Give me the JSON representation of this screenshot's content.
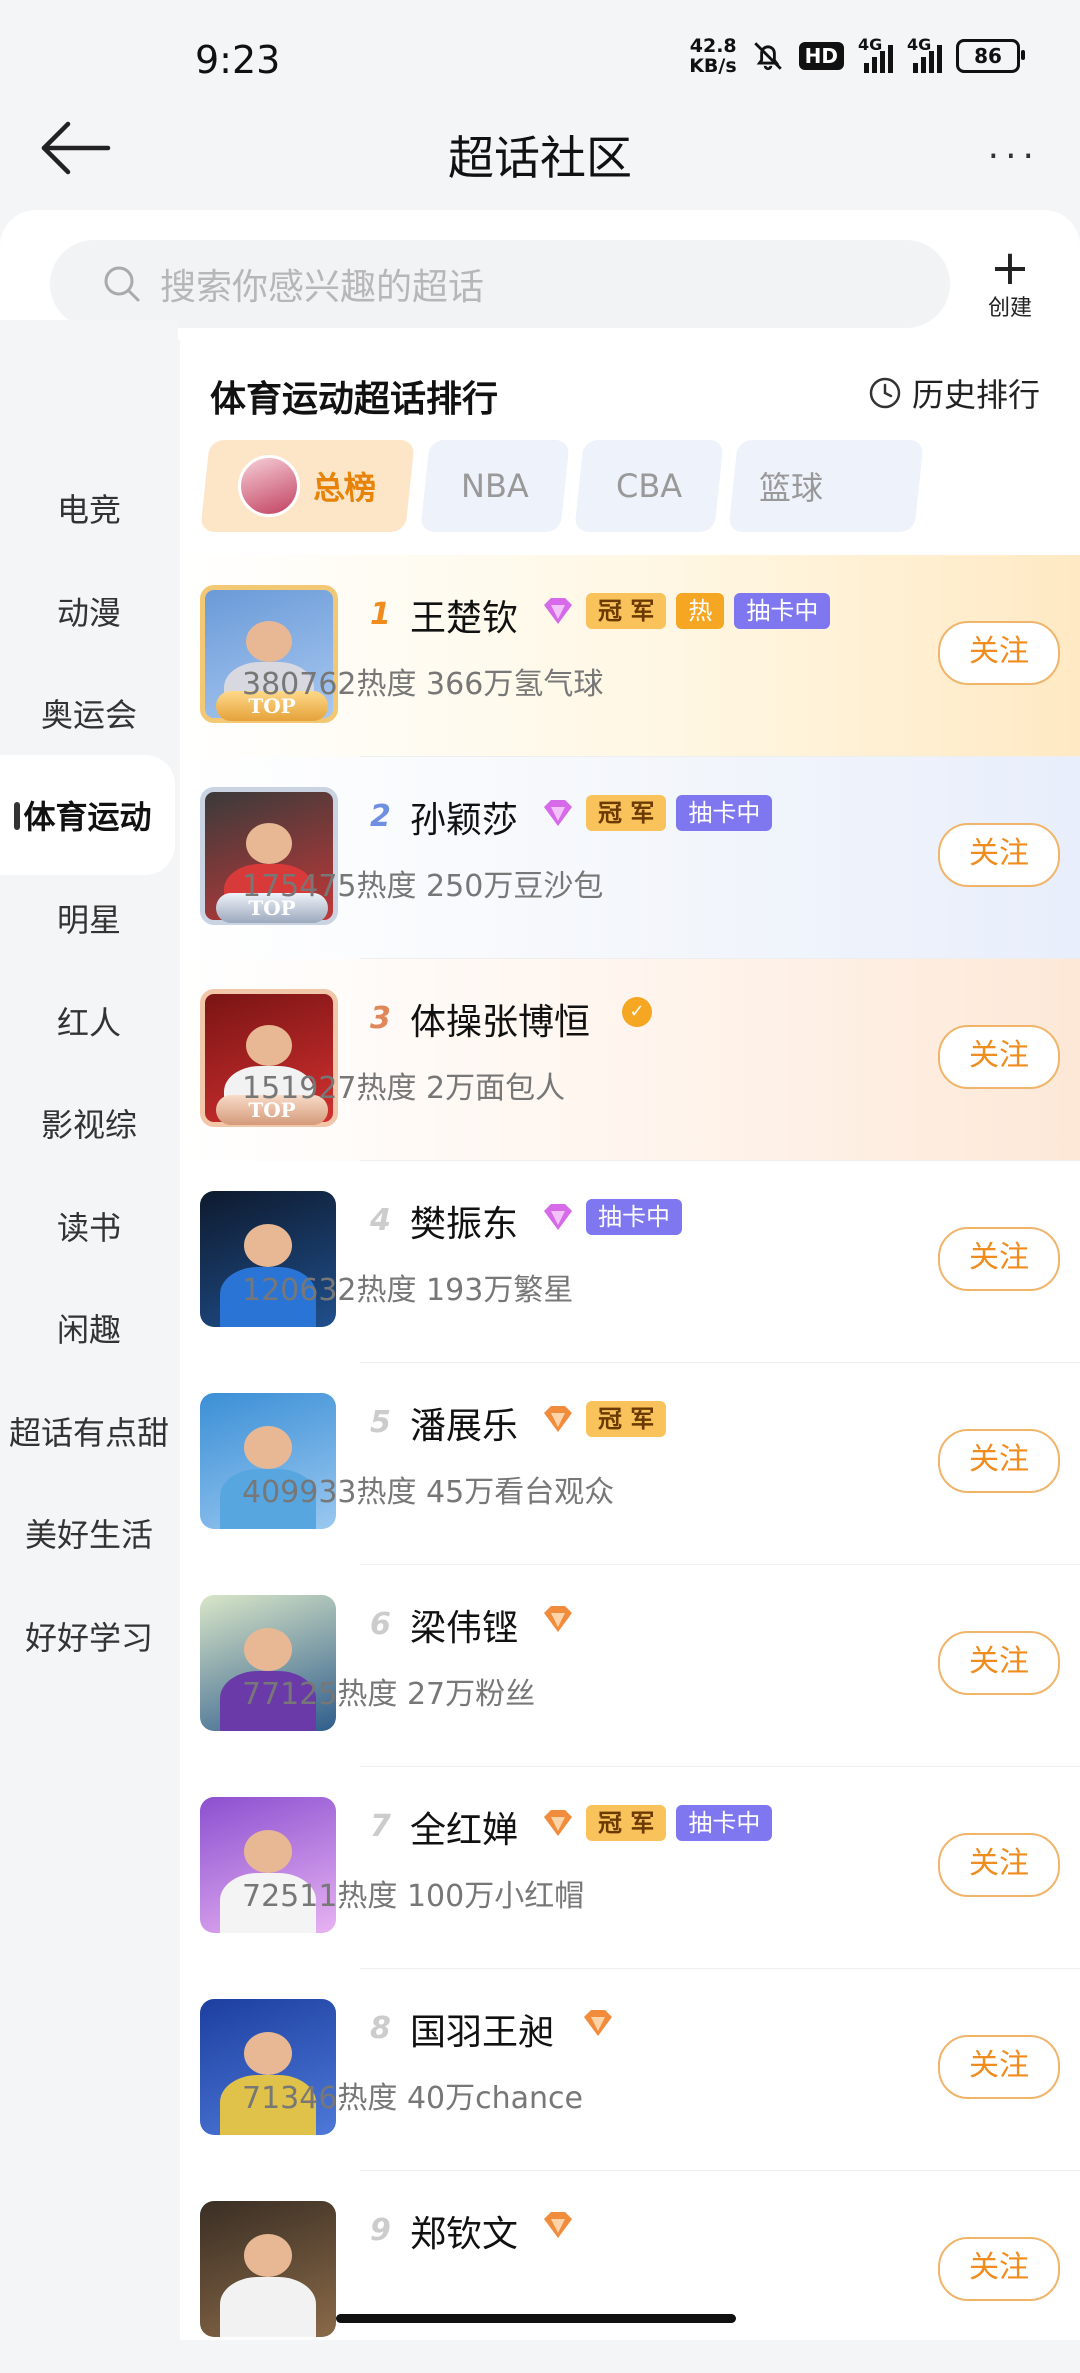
{
  "status_bar": {
    "time": "9:23",
    "net_speed_value": "42.8",
    "net_speed_unit": "KB/s",
    "hd_label": "HD",
    "signal1_label": "4G",
    "signal2_label": "4G",
    "battery": "86"
  },
  "header": {
    "title": "超话社区",
    "back_icon": "arrow-left-icon",
    "more_label": "···"
  },
  "search": {
    "placeholder": "搜索你感兴趣的超话",
    "create_label": "创建"
  },
  "sidebar": {
    "items": [
      {
        "label": "电竞"
      },
      {
        "label": "动漫"
      },
      {
        "label": "奥运会"
      },
      {
        "label": "体育运动"
      },
      {
        "label": "明星"
      },
      {
        "label": "红人"
      },
      {
        "label": "影视综"
      },
      {
        "label": "读书"
      },
      {
        "label": "闲趣"
      },
      {
        "label": "超话有点甜"
      },
      {
        "label": "美好生活"
      },
      {
        "label": "好好学习"
      }
    ],
    "active_index": 3
  },
  "ranking": {
    "title": "体育运动超话排行",
    "history_label": "历史排行",
    "tabs": [
      {
        "label": "总榜",
        "active": true
      },
      {
        "label": "NBA",
        "active": false
      },
      {
        "label": "CBA",
        "active": false
      },
      {
        "label": "篮球",
        "active": false
      }
    ],
    "follow_label": "关注",
    "top_label": "TOP",
    "tag_champion": "冠 军",
    "tag_hot": "热",
    "tag_card": "抽卡中",
    "items": [
      {
        "rank": "1",
        "name": "王楚钦",
        "stats": "380762热度 366万氢气球"
      },
      {
        "rank": "2",
        "name": "孙颖莎",
        "stats": "175475热度 250万豆沙包"
      },
      {
        "rank": "3",
        "name": "体操张博恒",
        "stats": "151927热度 2万面包人"
      },
      {
        "rank": "4",
        "name": "樊振东",
        "stats": "120632热度 193万繁星"
      },
      {
        "rank": "5",
        "name": "潘展乐",
        "stats": "409933热度 45万看台观众"
      },
      {
        "rank": "6",
        "name": "梁伟铿",
        "stats": "77125热度 27万粉丝"
      },
      {
        "rank": "7",
        "name": "全红婵",
        "stats": "72511热度 100万小红帽"
      },
      {
        "rank": "8",
        "name": "国羽王昶",
        "stats": "71346热度 40万chance"
      },
      {
        "rank": "9",
        "name": "郑钦文",
        "stats": ""
      }
    ]
  },
  "colors": {
    "accent": "#f08c1d",
    "card_tag": "#7f77f0",
    "champion_tag": "#f9c25a"
  }
}
